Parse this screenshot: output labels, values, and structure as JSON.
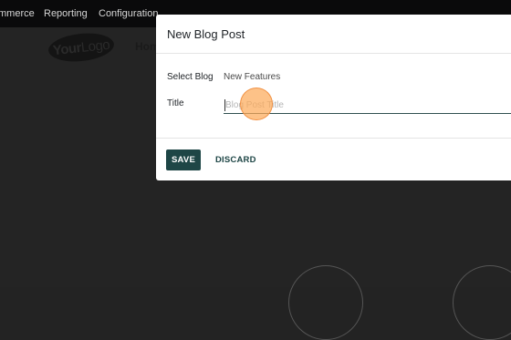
{
  "topbar": {
    "menu_items": [
      "mmerce",
      "Reporting",
      "Configuration"
    ]
  },
  "website": {
    "logo_text_bold": "Your",
    "logo_text_light": "Logo",
    "home_link": "Hom"
  },
  "dialog": {
    "title": "New Blog Post",
    "select_blog_label": "Select Blog",
    "select_blog_value": "New Features",
    "title_label": "Title",
    "title_placeholder": "Blog Post Title",
    "title_value": "",
    "save_label": "SAVE",
    "discard_label": "DISCARD"
  },
  "colors": {
    "primary": "#1e4646",
    "backdrop": "#232323",
    "topbar": "#0a0a0b",
    "cursor_highlight": "#fcaa5a"
  }
}
